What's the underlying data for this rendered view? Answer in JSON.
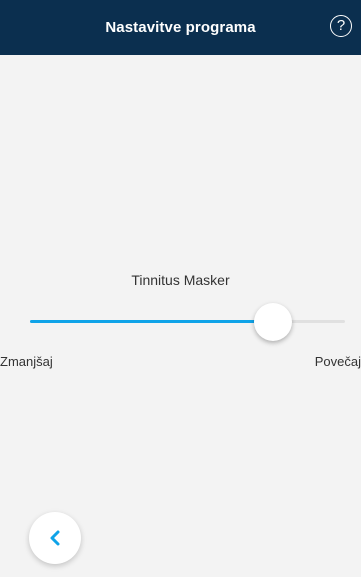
{
  "header": {
    "title": "Nastavitve programa",
    "help_icon": "question-circle-icon",
    "help_glyph": "?"
  },
  "slider": {
    "label": "Tinnitus Masker",
    "min_label": "Zmanjšaj",
    "max_label": "Povečaj",
    "value_fraction": 0.77
  },
  "footer": {
    "back_icon": "chevron-left-icon"
  },
  "colors": {
    "header_bg": "#0b2f4f",
    "accent": "#0fa3e8",
    "background": "#f3f3f3"
  }
}
